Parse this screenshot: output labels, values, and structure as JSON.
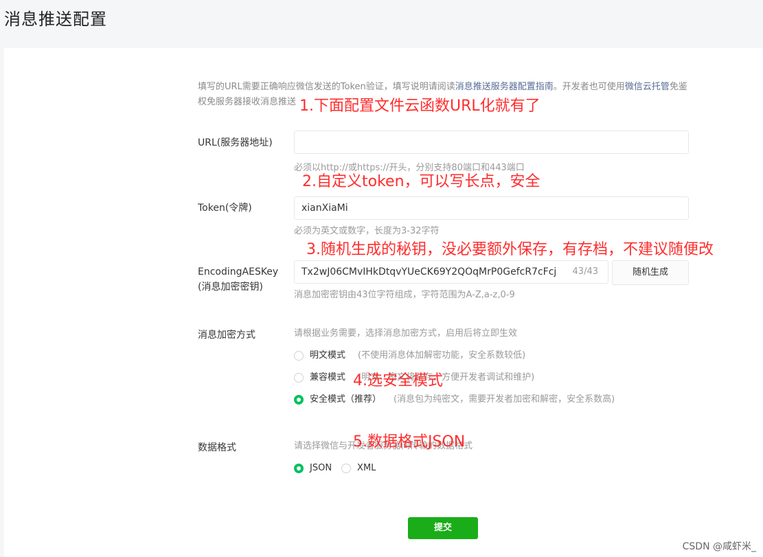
{
  "page": {
    "title": "消息推送配置"
  },
  "description": {
    "text_before_link": "填写的URL需要正确响应微信发送的Token验证，填写说明请阅读",
    "link1": "消息推送服务器配置指南",
    "text_middle": "。开发者也可使用",
    "link2": "微信云托管",
    "text_after": "免鉴权免服务器接收消息推送"
  },
  "url_field": {
    "label": "URL(服务器地址)",
    "value": "",
    "hint": "必须以http://或https://开头，分别支持80端口和443端口"
  },
  "token_field": {
    "label": "Token(令牌)",
    "value": "xianXiaMi",
    "hint": "必须为英文或数字，长度为3-32字符"
  },
  "aes_field": {
    "label_line1": "EncodingAESKey",
    "label_line2": "(消息加密密钥)",
    "value": "Tx2wJ06CMvIHkDtqvYUeCK69Y2QOqMrP0GefcR7cFcj",
    "counter": "43/43",
    "random_button": "随机生成",
    "hint": "消息加密密钥由43位字符组成，字符范围为A-Z,a-z,0-9"
  },
  "encrypt_mode": {
    "label": "消息加密方式",
    "hint": "请根据业务需要，选择消息加密方式，启用后将立即生效",
    "options": [
      {
        "label": "明文模式",
        "desc": "(不使用消息体加解密功能，安全系数较低)",
        "checked": false
      },
      {
        "label": "兼容模式",
        "desc": "(明文、密文将共存，方便开发者调试和维护)",
        "checked": false
      },
      {
        "label": "安全模式（推荐）",
        "desc": "(消息包为纯密文，需要开发者加密和解密，安全系数高)",
        "checked": true
      }
    ]
  },
  "data_format": {
    "label": "数据格式",
    "hint": "请选择微信与开发者服务器间传输的数据格式",
    "options": [
      {
        "label": "JSON",
        "checked": true
      },
      {
        "label": "XML",
        "checked": false
      }
    ]
  },
  "submit_button": "提交",
  "annotations": {
    "a1": "1.下面配置文件云函数URL化就有了",
    "a2": "2.自定义token，可以写长点，安全",
    "a3": "3.随机生成的秘钥，没必要额外保存，有存档，不建议随便改",
    "a4": "4.选安全模式",
    "a5": "5.数据格式JSON"
  },
  "watermark": "CSDN @咸虾米_",
  "colors": {
    "accent_green": "#07c160",
    "submit_green": "#1aad19",
    "link": "#576b95",
    "annotation_red": "#ff2d2d"
  }
}
